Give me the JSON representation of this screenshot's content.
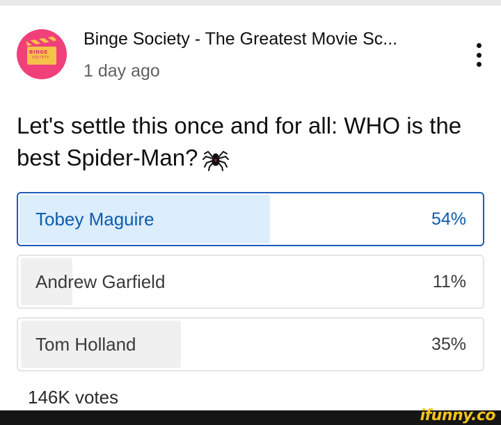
{
  "post": {
    "channel_name": "Binge Society - The Greatest Movie Sc...",
    "time": "1 day ago",
    "avatar_text_top": "BINGE",
    "avatar_text_bottom": "SOCIETY",
    "avatar_color": "#f0407a",
    "question": "Let's settle this once and for all: WHO is the best Spider-Man?",
    "question_emoji": "spider-icon",
    "menu_icon": "more-vert-icon"
  },
  "poll": {
    "options": [
      {
        "label": "Tobey Maguire",
        "percent_label": "54%",
        "percent": 54,
        "selected": true
      },
      {
        "label": "Andrew Garfield",
        "percent_label": "11%",
        "percent": 11,
        "selected": false
      },
      {
        "label": "Tom Holland",
        "percent_label": "35%",
        "percent": 35,
        "selected": false
      }
    ],
    "votes": "146K votes",
    "selected_color": "#1a5ab8"
  },
  "watermark": "ifunny.co"
}
